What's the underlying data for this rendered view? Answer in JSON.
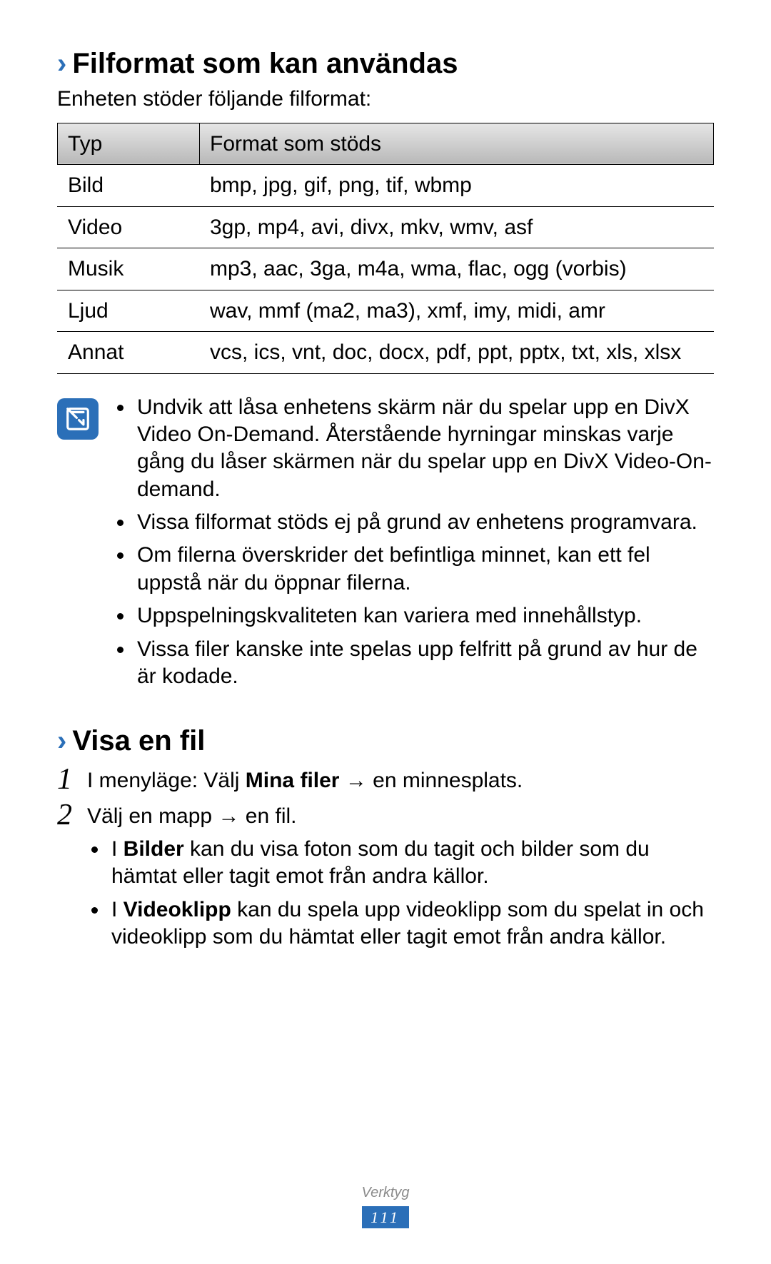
{
  "section1": {
    "title": "Filformat som kan användas",
    "subtitle": "Enheten stöder följande filformat:",
    "table": {
      "head": {
        "c0": "Typ",
        "c1": "Format som stöds"
      },
      "rows": [
        {
          "c0": "Bild",
          "c1": "bmp, jpg, gif, png, tif, wbmp"
        },
        {
          "c0": "Video",
          "c1": "3gp, mp4, avi, divx, mkv, wmv, asf"
        },
        {
          "c0": "Musik",
          "c1": "mp3, aac, 3ga, m4a, wma, flac, ogg (vorbis)"
        },
        {
          "c0": "Ljud",
          "c1": "wav, mmf (ma2, ma3), xmf, imy, midi, amr"
        },
        {
          "c0": "Annat",
          "c1": "vcs, ics, vnt, doc, docx, pdf, ppt, pptx, txt, xls, xlsx"
        }
      ]
    },
    "notes": [
      "Undvik att låsa enhetens skärm när du spelar upp en DivX Video On-Demand. Återstående hyrningar minskas varje gång du låser skärmen när du spelar upp en DivX Video-On-demand.",
      "Vissa filformat stöds ej på grund av enhetens programvara.",
      "Om filerna överskrider det befintliga minnet, kan ett fel uppstå när du öppnar filerna.",
      "Uppspelningskvaliteten kan variera med innehållstyp.",
      "Vissa filer kanske inte spelas upp felfritt på grund av hur de är kodade."
    ]
  },
  "section2": {
    "title": "Visa en fil",
    "step1": {
      "pre": "I menyläge: Välj ",
      "bold": "Mina filer",
      "post": " → en minnesplats."
    },
    "step2": {
      "text": "Välj en mapp → en fil.",
      "bullets": [
        {
          "pre": "I ",
          "bold": "Bilder",
          "post": " kan du visa foton som du tagit och bilder som du hämtat eller tagit emot från andra källor."
        },
        {
          "pre": "I ",
          "bold": "Videoklipp",
          "post": " kan du spela upp videoklipp som du spelat in och videoklipp som du hämtat eller tagit emot från andra källor."
        }
      ]
    }
  },
  "footer": {
    "category": "Verktyg",
    "page": "111"
  }
}
